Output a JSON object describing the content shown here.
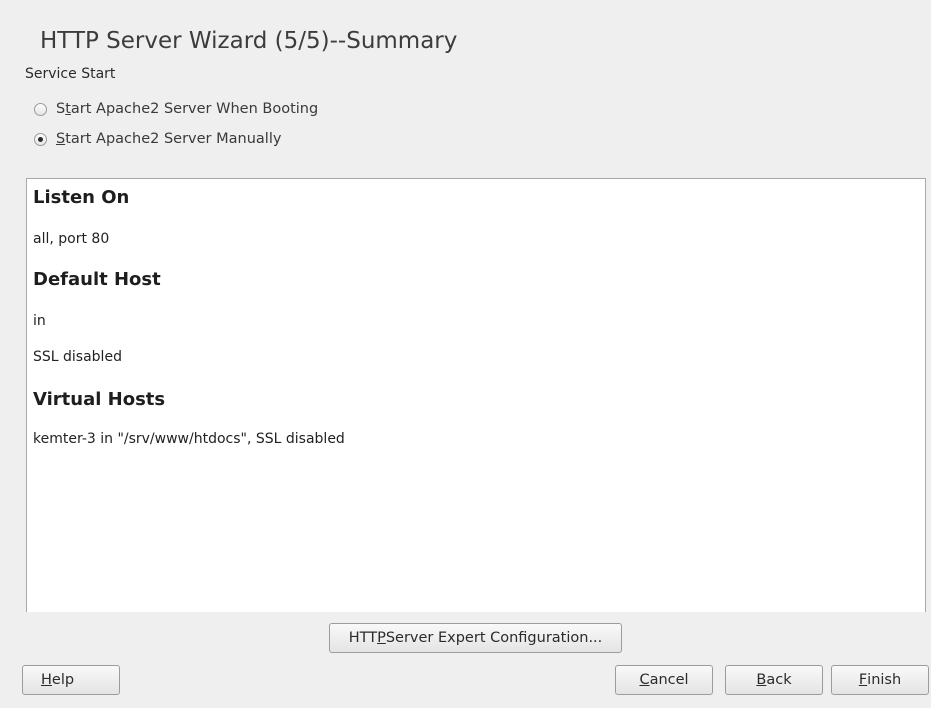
{
  "dialog": {
    "title": "HTTP Server Wizard (5/5)--Summary"
  },
  "service_start": {
    "label": "Service Start",
    "options": [
      {
        "prefix": "S",
        "mnemonic": "t",
        "rest": "art Apache2 Server When Booting",
        "selected": false
      },
      {
        "prefix": "",
        "mnemonic": "S",
        "rest": "tart Apache2 Server Manually",
        "selected": true
      }
    ]
  },
  "summary": {
    "listen_on_heading": "Listen On",
    "listen_on_value": "all, port 80",
    "default_host_heading": "Default Host",
    "default_host_value": "in",
    "default_host_ssl": "SSL disabled",
    "virtual_hosts_heading": "Virtual Hosts",
    "virtual_hosts_value": "kemter-3 in \"/srv/www/htdocs\", SSL disabled"
  },
  "buttons": {
    "expert": {
      "prefix": "HTT",
      "mnemonic": "P",
      "rest": " Server Expert Configuration..."
    },
    "help": {
      "prefix": "",
      "mnemonic": "H",
      "rest": "elp"
    },
    "cancel": {
      "prefix": "",
      "mnemonic": "C",
      "rest": "ancel"
    },
    "back": {
      "prefix": "",
      "mnemonic": "B",
      "rest": "ack"
    },
    "finish": {
      "prefix": "",
      "mnemonic": "F",
      "rest": "inish"
    }
  }
}
